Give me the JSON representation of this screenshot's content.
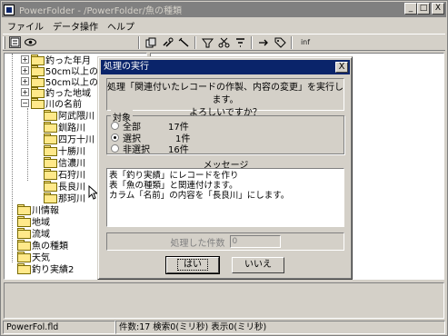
{
  "window": {
    "title": "PowerFolder - /PowerFolder/魚の種類",
    "min_label": "_",
    "max_label": "□",
    "close_label": "X"
  },
  "menu": [
    "ファイル",
    "データ操作",
    "ヘルプ"
  ],
  "toolbar": {
    "label_inf": "inf"
  },
  "tree": {
    "items": [
      {
        "label": "釣った年月",
        "expander": "+"
      },
      {
        "label": "50cm以上の",
        "expander": "+"
      },
      {
        "label": "50cm以上の",
        "expander": "+"
      },
      {
        "label": "釣った地域",
        "expander": "+"
      },
      {
        "label": "川の名前",
        "expander": "−"
      },
      {
        "label": "阿武隈川"
      },
      {
        "label": "釧路川"
      },
      {
        "label": "四万十川"
      },
      {
        "label": "十勝川"
      },
      {
        "label": "信濃川"
      },
      {
        "label": "石狩川"
      },
      {
        "label": "長良川"
      },
      {
        "label": "那珂川"
      },
      {
        "label": "川情報"
      },
      {
        "label": "地域"
      },
      {
        "label": "流域"
      },
      {
        "label": "魚の種類"
      },
      {
        "label": "天気"
      },
      {
        "label": "釣り実績2"
      }
    ]
  },
  "statusbar": {
    "file": "PowerFol.fld",
    "stats": "件数:17  検索0(ミリ秒)  表示0(ミリ秒)"
  },
  "dialog": {
    "title": "処理の実行",
    "close_label": "X",
    "message_line1": "処理「関連付いたレコードの作製、内容の変更」を実行します。",
    "message_line2": "よろしいですか？",
    "target_label": "対象",
    "options": [
      {
        "label": "全部",
        "count": "17件",
        "selected": false
      },
      {
        "label": "選択",
        "count": "1件",
        "selected": true
      },
      {
        "label": "非選択",
        "count": "16件",
        "selected": false
      }
    ],
    "message_header": "メッセージ",
    "messages": [
      "表「釣り実績」にレコードを作り",
      "表「魚の種類」と関連付けます。",
      "カラム「名前」の内容を「長良川」にします。"
    ],
    "processed_label": "処理した件数",
    "processed_value": "0",
    "yes_label": "はい",
    "no_label": "いいえ"
  }
}
